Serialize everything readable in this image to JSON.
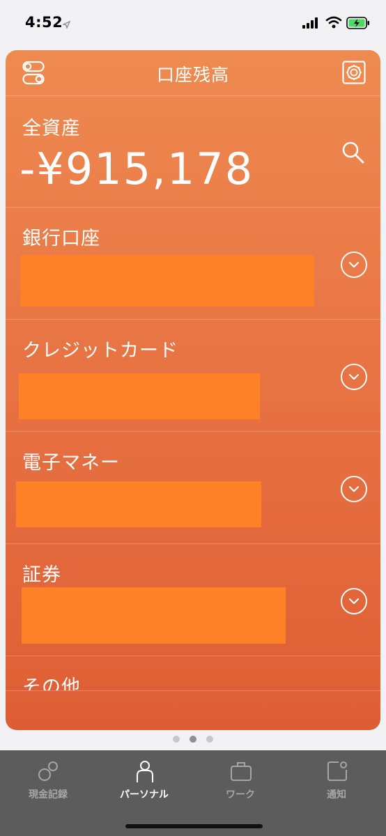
{
  "status_bar": {
    "time": "4:52",
    "icons": [
      "location-arrow-icon",
      "cellular-signal-icon",
      "wifi-icon",
      "battery-charging-icon"
    ]
  },
  "header": {
    "title": "口座残高",
    "left_icon": "toggle-switch-icon",
    "right_icon": "safe-icon"
  },
  "total": {
    "label": "全資産",
    "amount": "-¥915,178",
    "search_icon": "search-icon"
  },
  "sections": [
    {
      "label": "銀行口座",
      "expand_icon": "chevron-down-circle-icon"
    },
    {
      "label": "クレジットカード",
      "expand_icon": "chevron-down-circle-icon"
    },
    {
      "label": "電子マネー",
      "expand_icon": "chevron-down-circle-icon"
    },
    {
      "label": "証券",
      "expand_icon": "chevron-down-circle-icon"
    },
    {
      "label": "その他"
    }
  ],
  "pager": {
    "count": 3,
    "active_index": 1
  },
  "tabs": [
    {
      "label": "現金記録",
      "icon": "cash-record-icon",
      "active": false
    },
    {
      "label": "パーソナル",
      "icon": "person-icon",
      "active": true
    },
    {
      "label": "ワーク",
      "icon": "briefcase-icon",
      "active": false
    },
    {
      "label": "通知",
      "icon": "notification-icon",
      "active": false
    }
  ],
  "colors": {
    "card_top": "#ee8a50",
    "card_bottom": "#de5e34",
    "redaction": "#fe8027",
    "tab_bar": "#5c5c5c"
  }
}
